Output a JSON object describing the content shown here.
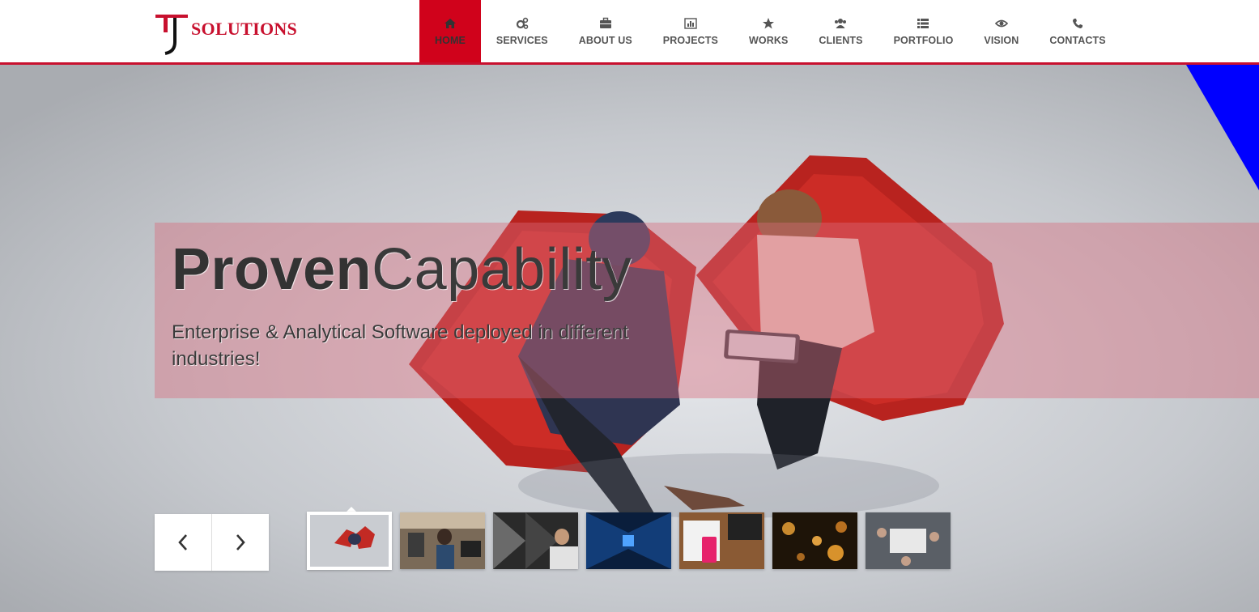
{
  "brand": {
    "name": "SOLUTIONS",
    "color": "#c8102e"
  },
  "nav": {
    "items": [
      {
        "label": "HOME",
        "icon": "home-icon",
        "active": true
      },
      {
        "label": "SERVICES",
        "icon": "gears-icon"
      },
      {
        "label": "ABOUT US",
        "icon": "briefcase-icon"
      },
      {
        "label": "PROJECTS",
        "icon": "bar-chart-icon"
      },
      {
        "label": "WORKS",
        "icon": "star-icon"
      },
      {
        "label": "CLIENTS",
        "icon": "users-icon"
      },
      {
        "label": "PORTFOLIO",
        "icon": "list-icon"
      },
      {
        "label": "VISION",
        "icon": "eye-icon"
      },
      {
        "label": "CONTACTS",
        "icon": "phone-icon"
      }
    ]
  },
  "hero": {
    "headline_bold": "Proven",
    "headline_light": "Capability",
    "subheadline": "Enterprise & Analytical Software deployed in different industries!",
    "prev_icon": "chevron-left-icon",
    "next_icon": "chevron-right-icon",
    "active_thumbnail": 1,
    "thumbnail_count": 7
  },
  "colors": {
    "accent": "#d0021b",
    "band": "#d86c7c",
    "corner": "#0000ff"
  }
}
